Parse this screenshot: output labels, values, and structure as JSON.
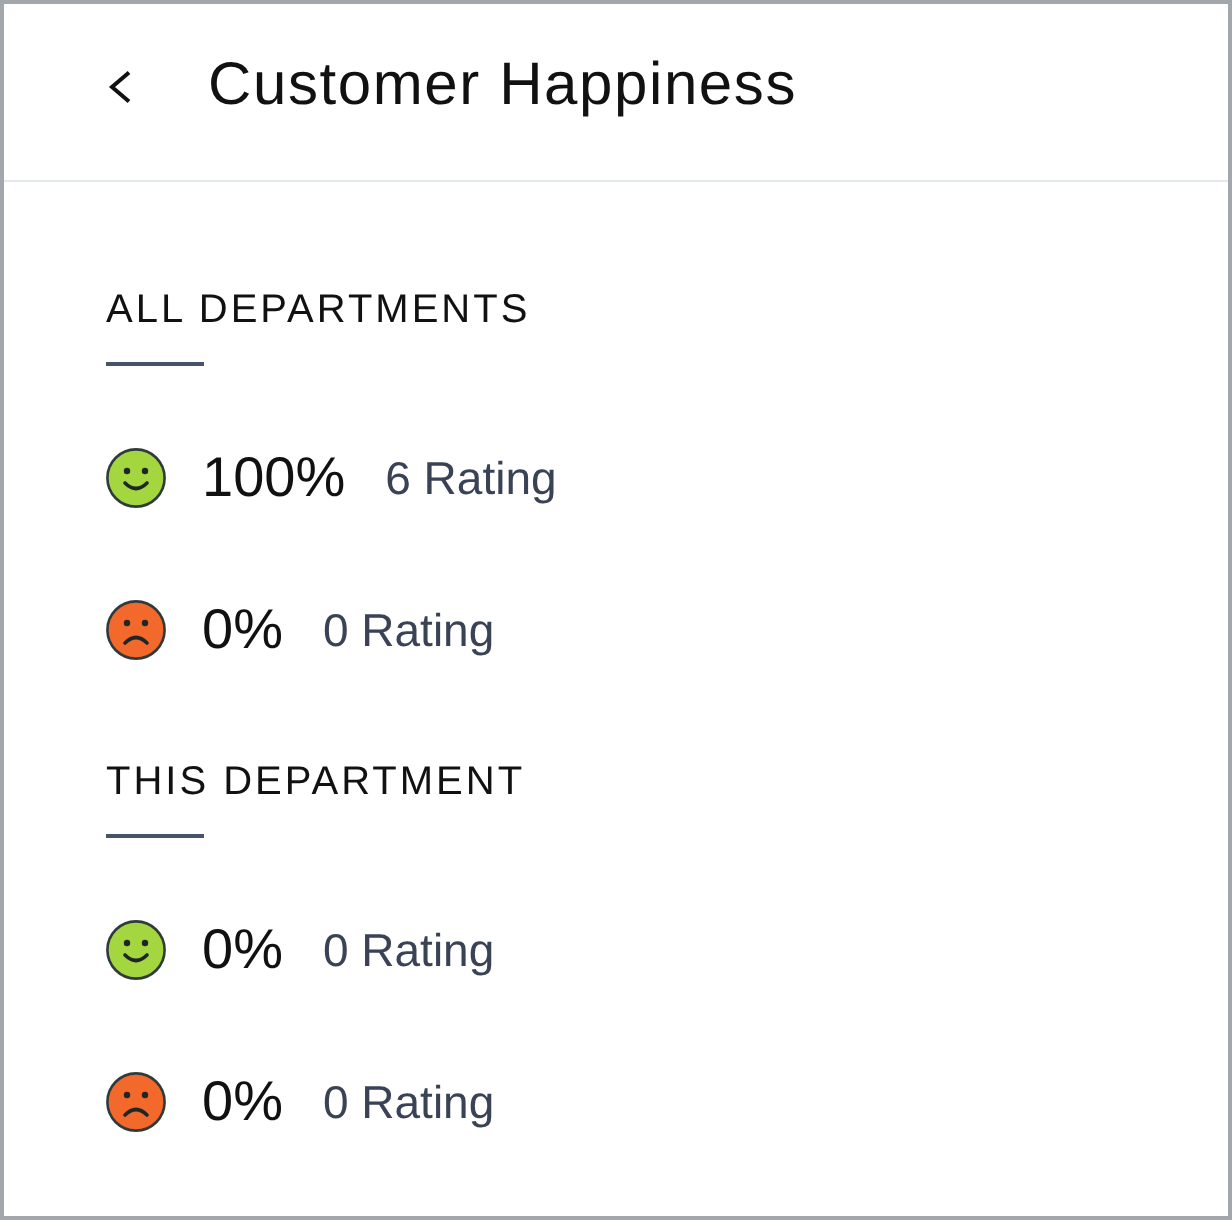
{
  "header": {
    "title": "Customer Happiness"
  },
  "sections": [
    {
      "heading": "ALL DEPARTMENTS",
      "ratings": [
        {
          "kind": "happy",
          "percent": "100%",
          "count": "6 Rating"
        },
        {
          "kind": "sad",
          "percent": "0%",
          "count": "0 Rating"
        }
      ]
    },
    {
      "heading": "THIS DEPARTMENT",
      "ratings": [
        {
          "kind": "happy",
          "percent": "0%",
          "count": "0 Rating"
        },
        {
          "kind": "sad",
          "percent": "0%",
          "count": "0 Rating"
        }
      ]
    }
  ]
}
